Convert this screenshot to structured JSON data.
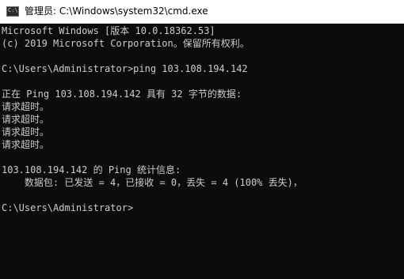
{
  "window": {
    "title": "管理员: C:\\Windows\\system32\\cmd.exe",
    "icon": "C:\\"
  },
  "console": {
    "lines": [
      "Microsoft Windows [版本 10.0.18362.53]",
      "(c) 2019 Microsoft Corporation。保留所有权利。",
      "",
      "C:\\Users\\Administrator>ping 103.108.194.142",
      "",
      "正在 Ping 103.108.194.142 具有 32 字节的数据:",
      "请求超时。",
      "请求超时。",
      "请求超时。",
      "请求超时。",
      "",
      "103.108.194.142 的 Ping 统计信息:",
      "    数据包: 已发送 = 4，已接收 = 0，丢失 = 4 (100% 丢失)，",
      "",
      "C:\\Users\\Administrator>"
    ]
  },
  "colors": {
    "background": "#0c0c0c",
    "text": "#cccccc",
    "titlebar": "#ffffff"
  }
}
